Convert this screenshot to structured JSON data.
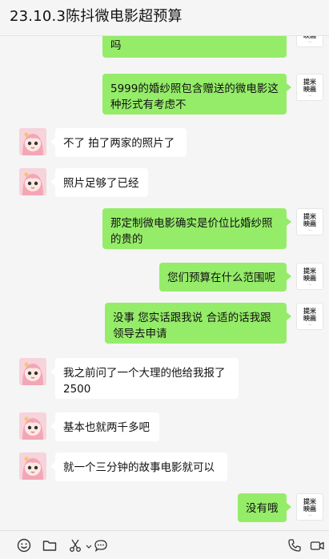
{
  "header": {
    "title": "23.10.3陈抖微电影超预算"
  },
  "brand_avatar": {
    "line1": "提米",
    "line2": "映画",
    "line3": "·—"
  },
  "messages": [
    {
      "side": "out",
      "text": "吗"
    },
    {
      "side": "out",
      "text": "5999的婚纱照包含赠送的微电影这种形式有考虑不"
    },
    {
      "side": "in",
      "text": "不了 拍了两家的照片了"
    },
    {
      "side": "in",
      "text": "照片足够了已经"
    },
    {
      "side": "out",
      "text": "那定制微电影确实是价位比婚纱照的贵的"
    },
    {
      "side": "out",
      "text": "您们预算在什么范围呢"
    },
    {
      "side": "out",
      "text": "没事 您实话跟我说  合适的话我跟领导去申请"
    },
    {
      "side": "in",
      "text": "我之前问了一个大理的他给我报了2500"
    },
    {
      "side": "in",
      "text": "基本也就两千多吧"
    },
    {
      "side": "in",
      "text": "就一个三分钟的故事电影就可以"
    },
    {
      "side": "out",
      "text": "没有哦"
    }
  ],
  "toolbar": {
    "left_icons": [
      "emoji-icon",
      "folder-icon",
      "scissors-icon",
      "chat-bubble-icon"
    ],
    "right_icons": [
      "phone-icon",
      "video-icon"
    ]
  },
  "colors": {
    "bubble_out": "#95ec69",
    "bubble_in": "#ffffff",
    "background": "#f5f5f5"
  }
}
